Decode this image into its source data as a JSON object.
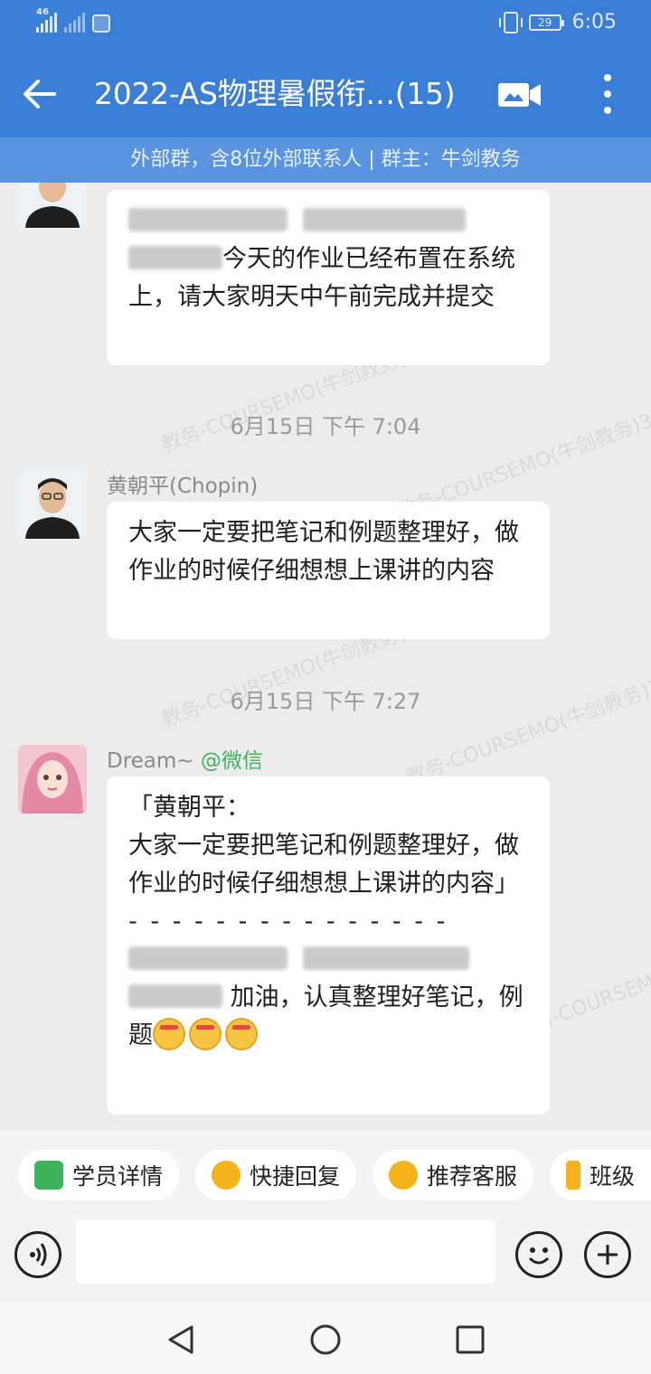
{
  "status_bar": {
    "network": "46",
    "battery": "29",
    "time": "6:05"
  },
  "header": {
    "title": "2022-AS物理暑假衔…(15)",
    "subtitle": "外部群，含8位外部联系人 | 群主：牛剑教务"
  },
  "messages": [
    {
      "text_visible": "今天的作业已经布置在系统上，请大家明天中午前完成并提交"
    },
    {
      "timestamp": "6月15日  下午 7:04",
      "sender": "黄朝平(Chopin)",
      "text": "大家一定要把笔记和例题整理好，做作业的时候仔细想想上课讲的内容"
    },
    {
      "timestamp": "6月15日  下午 7:27",
      "sender_name": "Dream~",
      "sender_source": "@微信",
      "quote_author": "「黄朝平：",
      "quote_text": "大家一定要把笔记和例题整理好，做作业的时候仔细想想上课讲的内容」",
      "divider": "- - - - - - - - - - - - - - -",
      "reply_text": "加油，认真整理好笔记，例题"
    }
  ],
  "watermark": "教务-COURSEMO(牛剑教务)3",
  "quick_actions": [
    {
      "label": "学员详情",
      "icon": "student-icon"
    },
    {
      "label": "快捷回复",
      "icon": "quick-reply-icon"
    },
    {
      "label": "推荐客服",
      "icon": "service-icon"
    },
    {
      "label": "班级",
      "icon": "class-icon"
    }
  ],
  "colors": {
    "header": "#3a7ed6",
    "subheader": "#5a93df",
    "chat_bg": "#ececec",
    "wechat_green": "#3db35e"
  }
}
